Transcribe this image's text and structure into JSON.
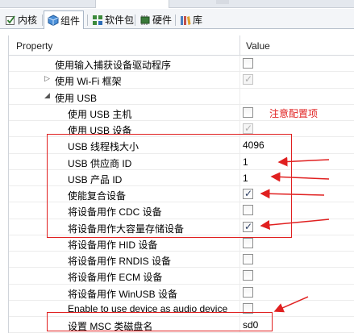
{
  "tabs": [
    {
      "label": "内核",
      "icon": "checkbox-icon",
      "active": false
    },
    {
      "label": "组件",
      "icon": "cube-icon",
      "active": true
    },
    {
      "label": "软件包",
      "icon": "grid-icon",
      "active": false
    },
    {
      "label": "硬件",
      "icon": "chip-icon",
      "active": false
    },
    {
      "label": "库",
      "icon": "library-icon",
      "active": false
    }
  ],
  "table": {
    "header_property": "Property",
    "header_value": "Value",
    "rows": [
      {
        "label": "使用输入捕获设备驱动程序",
        "value_type": "checkbox",
        "checked": false,
        "disabled": false
      },
      {
        "label": "使用 Wi-Fi 框架",
        "value_type": "checkbox",
        "checked": true,
        "disabled": true,
        "expander": "collapsed"
      },
      {
        "label": "使用 USB",
        "value_type": "none",
        "expander": "expanded"
      },
      {
        "label": "使用 USB 主机",
        "value_type": "checkbox",
        "checked": false,
        "disabled": false
      },
      {
        "label": "使用 USB 设备",
        "value_type": "checkbox",
        "checked": true,
        "disabled": true
      },
      {
        "label": "USB 线程栈大小",
        "value_type": "text",
        "value": "4096"
      },
      {
        "label": "USB 供应商 ID",
        "value_type": "text",
        "value": "1"
      },
      {
        "label": "USB 产品 ID",
        "value_type": "text",
        "value": "1"
      },
      {
        "label": "使能复合设备",
        "value_type": "checkbox",
        "checked": true,
        "disabled": false
      },
      {
        "label": "将设备用作 CDC 设备",
        "value_type": "checkbox",
        "checked": false,
        "disabled": false
      },
      {
        "label": "将设备用作大容量存储设备",
        "value_type": "checkbox",
        "checked": true,
        "disabled": false
      },
      {
        "label": "将设备用作 HID 设备",
        "value_type": "checkbox",
        "checked": false,
        "disabled": false
      },
      {
        "label": "将设备用作 RNDIS 设备",
        "value_type": "checkbox",
        "checked": false,
        "disabled": false
      },
      {
        "label": "将设备用作 ECM 设备",
        "value_type": "checkbox",
        "checked": false,
        "disabled": false
      },
      {
        "label": "将设备用作 WinUSB 设备",
        "value_type": "checkbox",
        "checked": false,
        "disabled": false
      },
      {
        "label": "Enable to use device as audio device",
        "value_type": "checkbox",
        "checked": false,
        "disabled": false
      },
      {
        "label": "设置 MSC 类磁盘名",
        "value_type": "text",
        "value": "sd0"
      }
    ]
  },
  "annotation": {
    "note": "注意配置项",
    "color": "#e02020"
  }
}
